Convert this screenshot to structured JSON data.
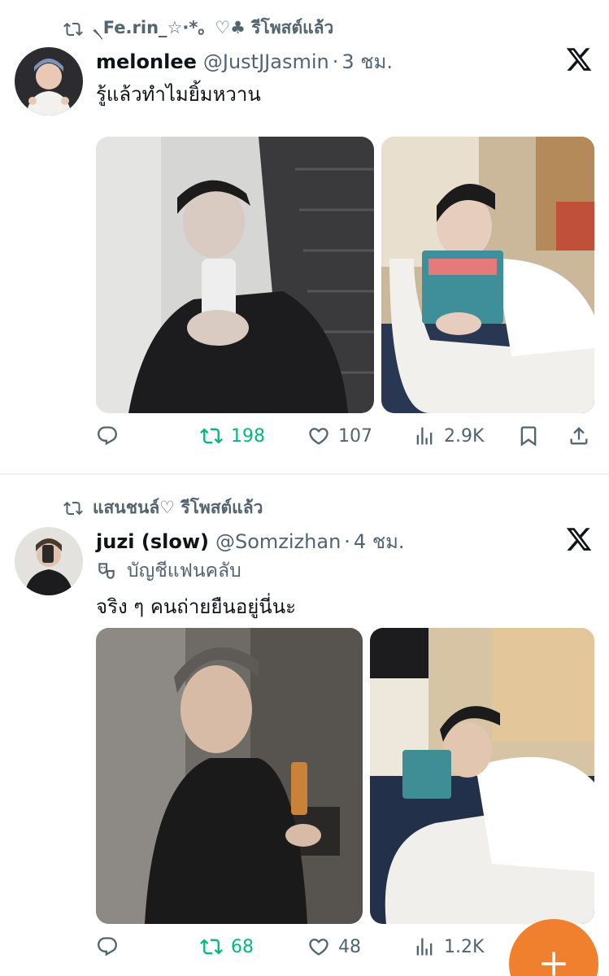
{
  "colors": {
    "accent_green": "#00ba7c",
    "muted": "#536471",
    "fab": "#f07f2e"
  },
  "posts": [
    {
      "repost_user": "৲Fe.rin_☆·*。♡♣",
      "repost_text": "รีโพสต์แล้ว",
      "name": "melonlee",
      "handle": "@JustJJasmin",
      "dot": "·",
      "time": "3 ชม.",
      "text": "รู้แล้วทำไมยิ้มหวาน",
      "stats": {
        "replies": "",
        "reposts": "198",
        "likes": "107",
        "views": "2.9K"
      }
    },
    {
      "repost_user": "แสนชนล์♡",
      "repost_text": "รีโพสต์แล้ว",
      "name": "juzi (slow)",
      "handle": "@Somzizhan",
      "dot": "·",
      "time": "4 ชม.",
      "badge": "บัญชีแฟนคลับ",
      "text": "จริง ๆ คนถ่ายยืนอยู่นี่นะ",
      "stats": {
        "replies": "",
        "reposts": "68",
        "likes": "48",
        "views": "1.2K"
      }
    }
  ]
}
